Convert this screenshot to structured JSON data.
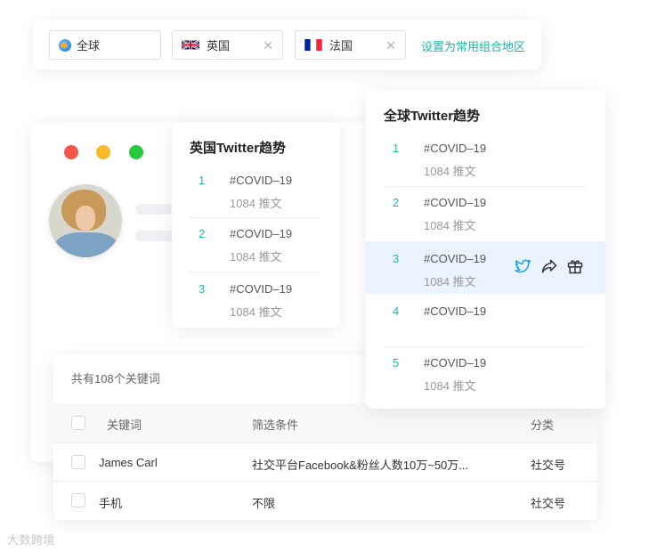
{
  "region_bar": {
    "chips": [
      {
        "label": "全球",
        "icon": "globe-icon"
      },
      {
        "label": "英国",
        "icon": "uk-flag-icon",
        "closable": true
      },
      {
        "label": "法国",
        "icon": "france-flag-icon",
        "closable": true
      }
    ],
    "close_glyph": "✕",
    "set_common_link": "设置为常用组合地区"
  },
  "window": {
    "dot_colors": [
      "#f2564a",
      "#f7b928",
      "#27c93f"
    ]
  },
  "uk_trends": {
    "title": "英国Twitter趋势",
    "items": [
      {
        "rank": "1",
        "tag": "#COVID–19",
        "count": "1084 推文"
      },
      {
        "rank": "2",
        "tag": "#COVID–19",
        "count": "1084 推文"
      },
      {
        "rank": "3",
        "tag": "#COVID–19",
        "count": "1084 推文"
      }
    ]
  },
  "global_trends": {
    "title": "全球Twitter趋势",
    "items": [
      {
        "rank": "1",
        "tag": "#COVID–19",
        "count": "1084 推文"
      },
      {
        "rank": "2",
        "tag": "#COVID–19",
        "count": "1084 推文"
      },
      {
        "rank": "3",
        "tag": "#COVID–19",
        "count": "1084 推文"
      },
      {
        "rank": "4",
        "tag": "#COVID–19",
        "count": ""
      },
      {
        "rank": "5",
        "tag": "#COVID–19",
        "count": "1084 推文"
      }
    ],
    "highlighted_rank": "3",
    "actions": [
      "twitter-bird-icon",
      "share-icon",
      "gift-icon"
    ]
  },
  "keywords": {
    "summary": "共有108个关键词",
    "headers": {
      "keyword": "关键词",
      "filter": "筛选条件",
      "category": "分类"
    },
    "rows": [
      {
        "keyword": "James Carl",
        "filter": "社交平台Facebook&粉丝人数10万~50万...",
        "category": "社交号"
      },
      {
        "keyword": "手机",
        "filter": "不限",
        "category": "社交号"
      }
    ]
  },
  "watermark": "大数跨境",
  "colors": {
    "accent": "#1fb5a5",
    "highlight": "#eaf3ff",
    "twitter": "#1da1f2"
  }
}
